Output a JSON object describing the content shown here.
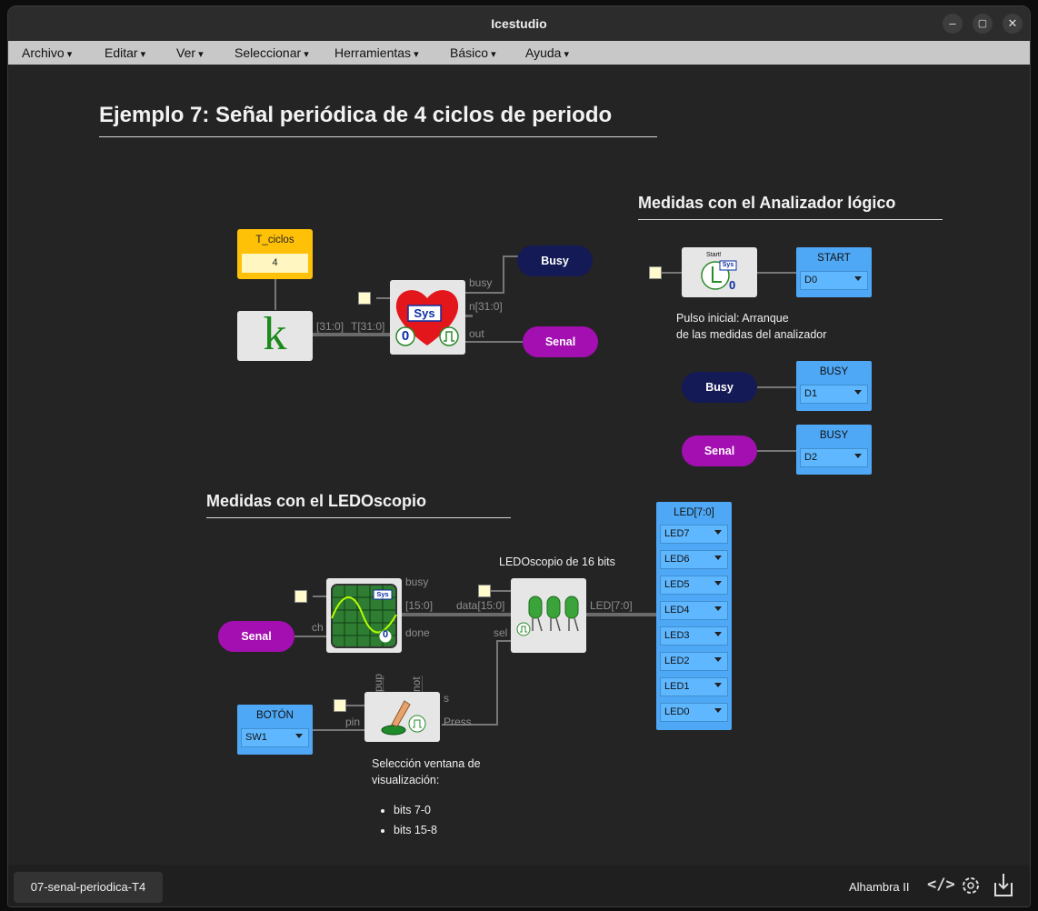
{
  "window": {
    "title": "Icestudio",
    "min": "–",
    "max": "▢",
    "close": "✕"
  },
  "menu": [
    "Archivo",
    "Editar",
    "Ver",
    "Seleccionar",
    "Herramientas",
    "Básico",
    "Ayuda"
  ],
  "title": "Ejemplo 7: Señal periódica de 4 ciclos de periodo",
  "heading_analyzer": "Medidas con el Analizador lógico",
  "heading_ledoscope": "Medidas con el LEDOscopio",
  "constant": {
    "name": "T_ciclos",
    "value": "4",
    "glyph": "k"
  },
  "heart": {
    "sys": "Sys",
    "zero": "0",
    "pulse": "⎍",
    "in_left": "[31:0]",
    "in_right": "T[31:0]",
    "busy": "busy",
    "n": "n[31:0]",
    "out": "out"
  },
  "labels": {
    "busy": "Busy",
    "senal": "Senal"
  },
  "start_block": {
    "caption": "Start!",
    "sys": "Sys",
    "zero": "0"
  },
  "analyzer_outputs": [
    {
      "name": "START",
      "value": "D0"
    },
    {
      "name": "BUSY",
      "value": "D1"
    },
    {
      "name": "BUSY",
      "value": "D2"
    }
  ],
  "pulse_note": [
    "Pulso inicial: Arranque",
    "de las medidas del analizador"
  ],
  "scope": {
    "sys": "Sys",
    "zero": "0",
    "ch": "ch",
    "busy": "busy",
    "bus": "[15:0]",
    "done": "done"
  },
  "ledoscope": {
    "title": "LEDOscopio de 16 bits",
    "data": "data[15:0]",
    "sel": "sel",
    "out": "LED[7:0]"
  },
  "button_block": {
    "pup": "pup",
    "not": "not",
    "s": "s",
    "pin": "pin",
    "press": "Press"
  },
  "boton": {
    "name": "BOTÓN",
    "value": "SW1"
  },
  "selection_note": {
    "lines": [
      "Selección ventana de",
      "visualización:"
    ],
    "bullets": [
      "bits 7-0",
      "bits 15-8"
    ]
  },
  "led_bus": {
    "name": "LED[7:0]",
    "items": [
      "LED7",
      "LED6",
      "LED5",
      "LED4",
      "LED3",
      "LED2",
      "LED1",
      "LED0"
    ]
  },
  "status": {
    "tab": "07-senal-periodica-T4",
    "board": "Alhambra II",
    "code_icon": "</>"
  }
}
